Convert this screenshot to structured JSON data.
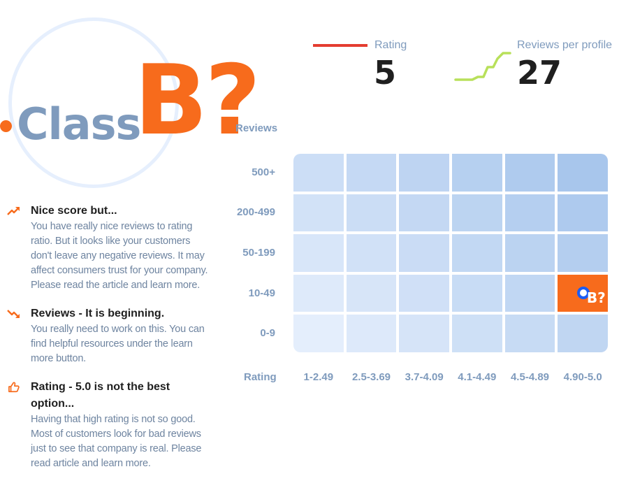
{
  "hero": {
    "prefix": "Class",
    "grade": "B?"
  },
  "metrics": {
    "rating": {
      "label": "Rating",
      "value": "5"
    },
    "reviews_per_profile": {
      "label": "Reviews per profile",
      "value": "27"
    }
  },
  "colors": {
    "accent": "#f76b1c",
    "rating_line": "#e43d30",
    "spark_line": "#b8e05a",
    "marker": "#1a5cf5",
    "axis_text": "#7f9bbd"
  },
  "chart_data": {
    "type": "heatmap",
    "title": "",
    "xlabel": "Rating",
    "ylabel": "Reviews",
    "x_categories": [
      "1-2.49",
      "2.5-3.69",
      "3.7-4.09",
      "4.1-4.49",
      "4.5-4.89",
      "4.90-5.0"
    ],
    "y_categories": [
      "500+",
      "200-499",
      "50-199",
      "10-49",
      "0-9"
    ],
    "highlight": {
      "x": "4.90-5.0",
      "y": "10-49",
      "label": "B?"
    },
    "grid": true,
    "legend": "none"
  },
  "insights": [
    {
      "icon": "trend-up-icon",
      "title": "Nice score but...",
      "body": "You have really nice reviews to rating ratio. But it looks like your customers don't leave any negative reviews. It may affect consumers trust for your company. Please read the article and learn more."
    },
    {
      "icon": "trend-down-icon",
      "title": "Reviews - It is beginning.",
      "body": "You really need to work on this. You can find helpful resources under the learn more button."
    },
    {
      "icon": "thumbs-up-icon",
      "title": "Rating - 5.0 is not the best option...",
      "body": "Having that high rating is not so good. Most of customers look for bad reviews just to see that company is real. Please read article and learn more."
    }
  ]
}
